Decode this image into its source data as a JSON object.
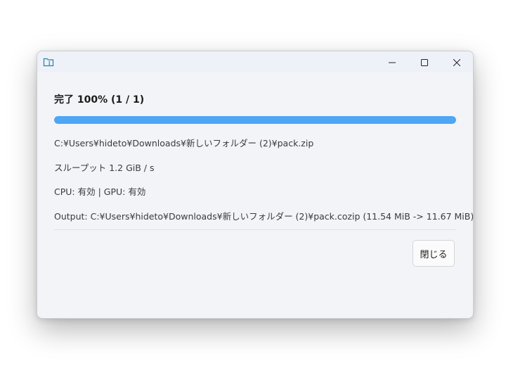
{
  "window": {
    "icon": "folder-zip-icon",
    "controls": {
      "minimize": "minimize-icon",
      "maximize": "maximize-icon",
      "close": "close-icon"
    }
  },
  "dialog": {
    "heading": "完了 100% (1 / 1)",
    "progress_fraction": 1.0,
    "progress_color": "#4ea6f5",
    "source_path": "C:¥Users¥hideto¥Downloads¥新しいフォルダー (2)¥pack.zip",
    "throughput": "スループット 1.2 GiB / s",
    "hardware": "CPU: 有効 | GPU: 有効",
    "output": "Output: C:¥Users¥hideto¥Downloads¥新しいフォルダー (2)¥pack.cozip (11.54 MiB -> 11.67 MiB)",
    "close_label": "閉じる"
  }
}
